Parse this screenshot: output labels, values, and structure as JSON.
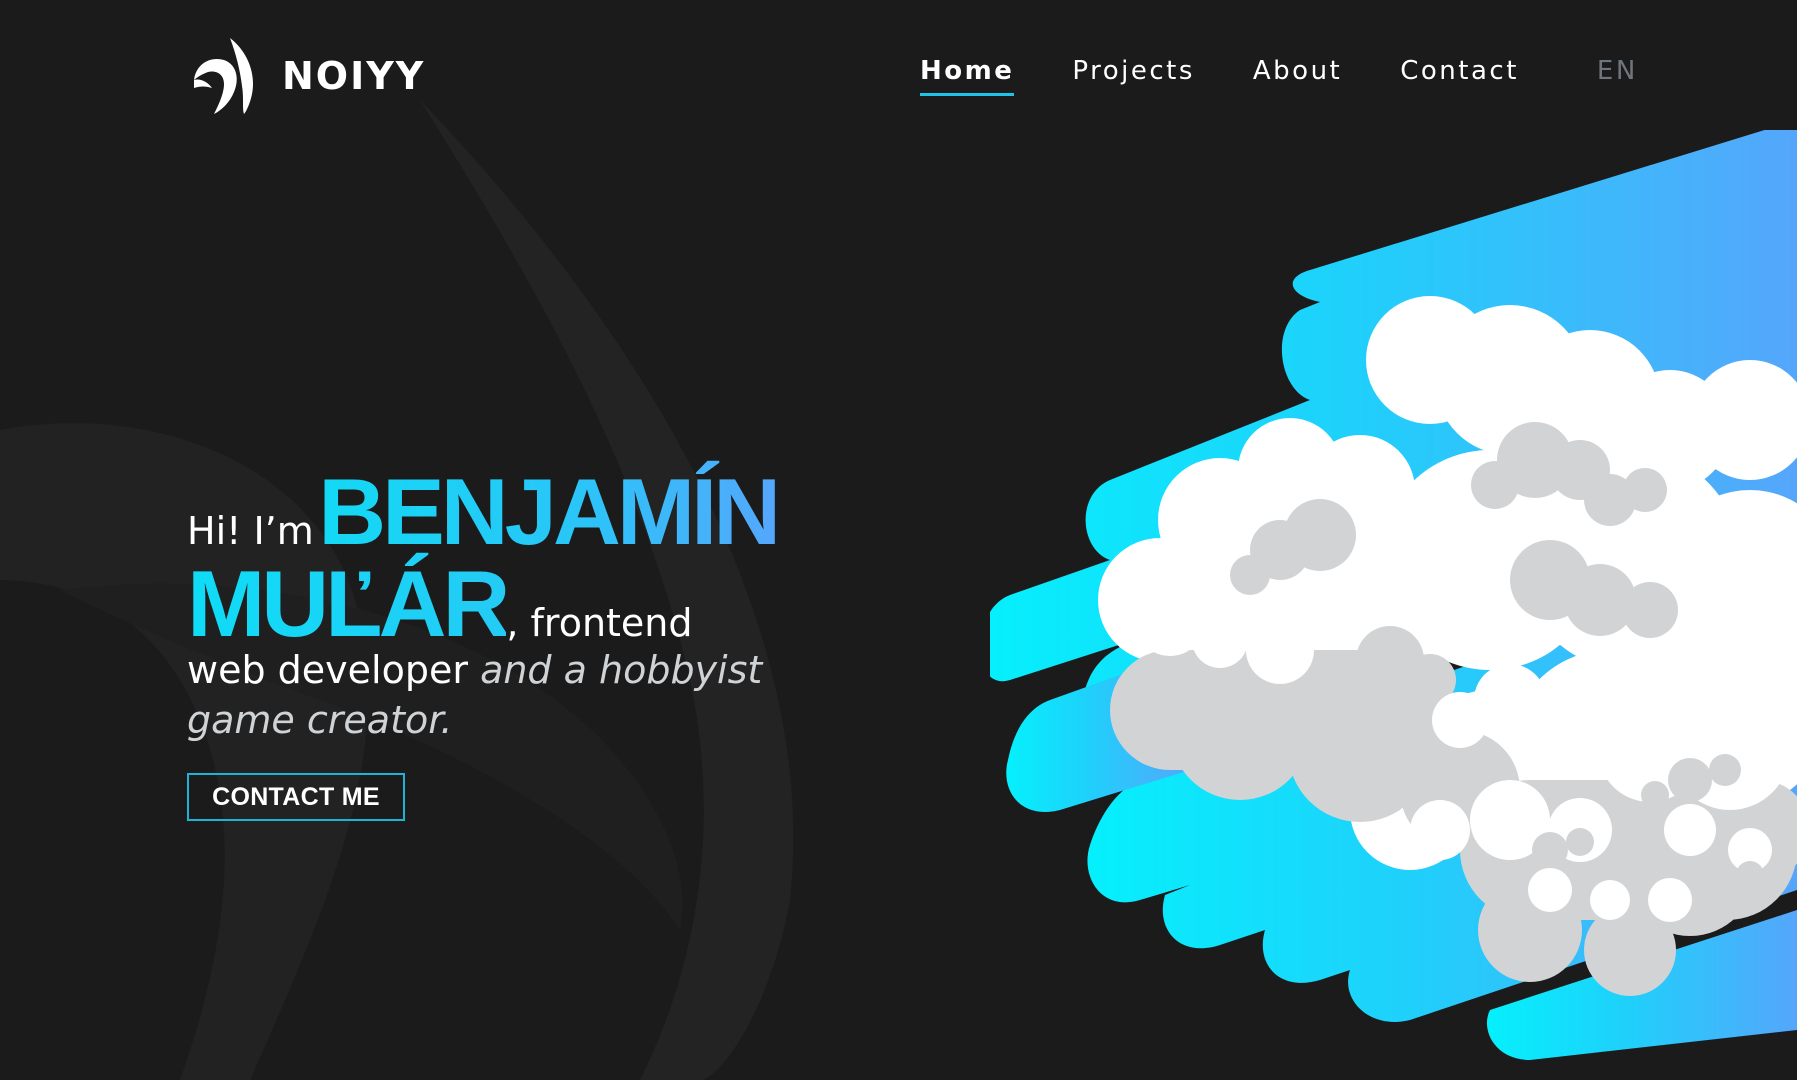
{
  "brand": {
    "name": "NOIYY",
    "logo_icon": "swirl-logo-icon"
  },
  "nav": {
    "items": [
      {
        "label": "Home",
        "active": true
      },
      {
        "label": "Projects",
        "active": false
      },
      {
        "label": "About",
        "active": false
      },
      {
        "label": "Contact",
        "active": false
      }
    ],
    "language": "EN"
  },
  "hero": {
    "greeting": "Hi! I’m",
    "first_name": "BENJAMÍN",
    "last_name": "MUĽÁR",
    "role_suffix": ", frontend",
    "role_line": "web developer",
    "hobby": "and a hobbyist game creator.",
    "cta_label": "CONTACT ME"
  },
  "colors": {
    "background": "#1b1b1b",
    "accent_cyan": "#13d9f4",
    "accent_blue": "#55a7fb",
    "nav_inactive": "#6f767b",
    "cloud_white": "#ffffff",
    "cloud_grey": "#d1d3d5"
  },
  "illustration": "cloud-swoosh-illustration"
}
